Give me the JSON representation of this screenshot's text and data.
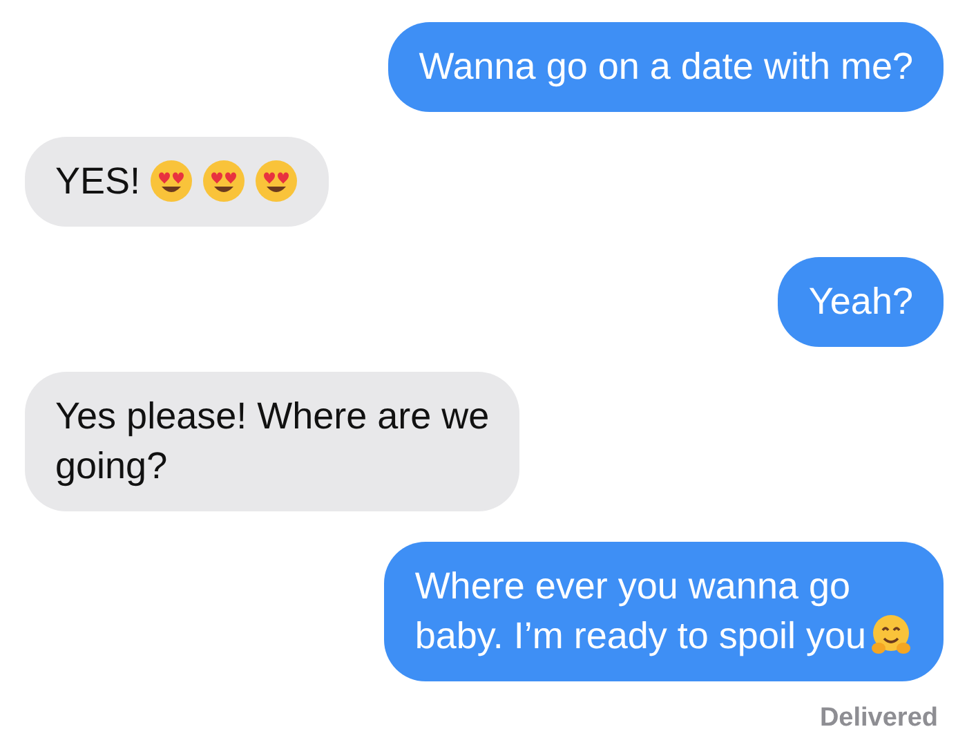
{
  "messages": [
    {
      "kind": "sent",
      "lines": [
        "Wanna go on a date with me?"
      ]
    },
    {
      "kind": "received",
      "lines": [
        "YES!"
      ],
      "emoji": [
        {
          "kind": "heart_eyes"
        },
        {
          "kind": "heart_eyes"
        },
        {
          "kind": "heart_eyes"
        }
      ]
    },
    {
      "kind": "sent",
      "lines": [
        "Yeah?"
      ]
    },
    {
      "kind": "received",
      "lines": [
        "Yes please! Where are we",
        "going?"
      ]
    },
    {
      "kind": "sent",
      "lines": [
        "Where ever you wanna go",
        "baby. I’m ready to spoil you"
      ],
      "emoji": [
        {
          "kind": "hug"
        }
      ]
    }
  ],
  "status": "Delivered"
}
